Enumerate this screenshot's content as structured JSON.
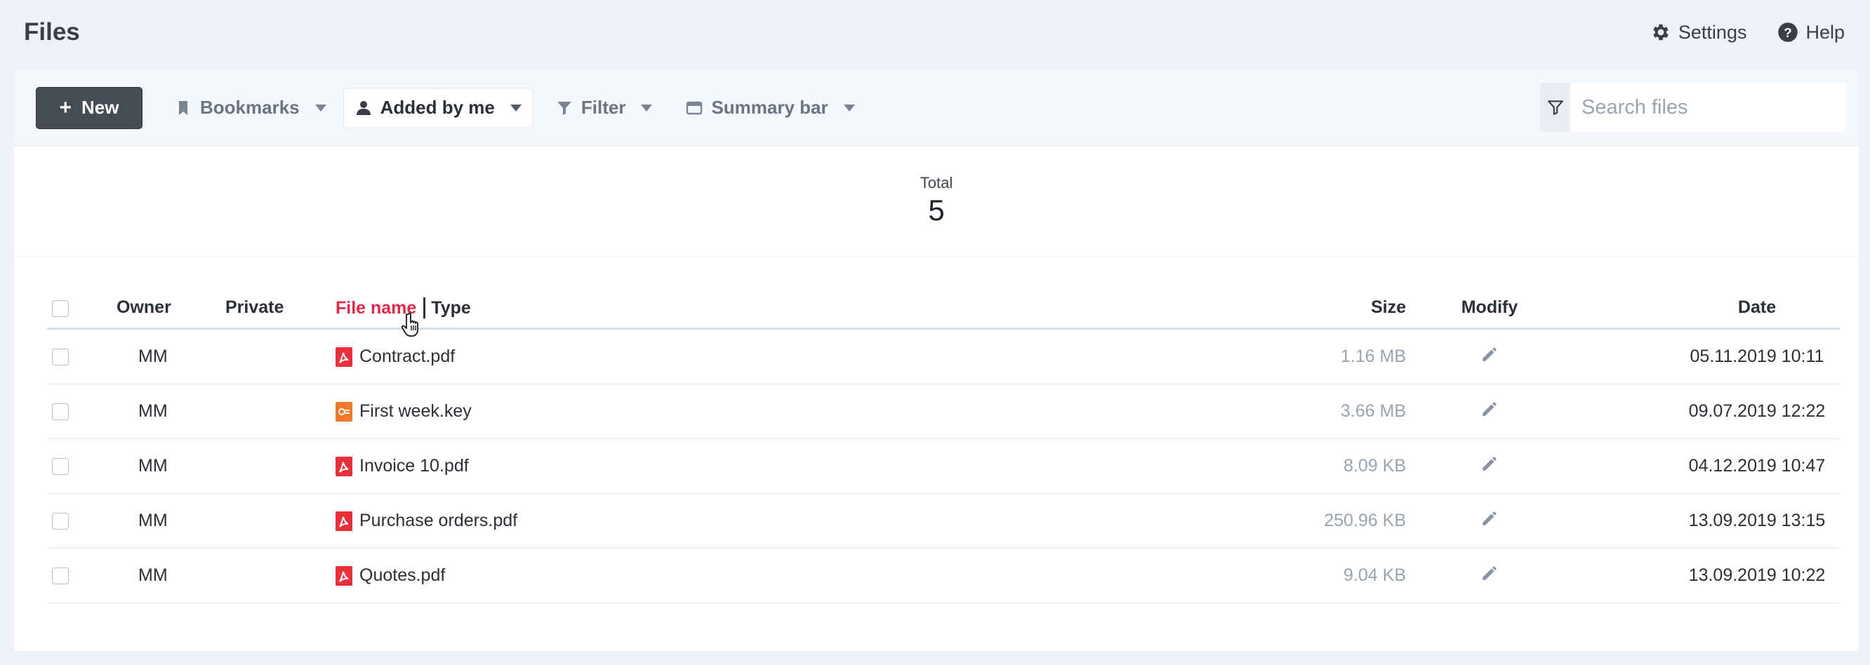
{
  "app": {
    "title": "Files"
  },
  "top_links": {
    "settings": "Settings",
    "help": "Help"
  },
  "toolbar": {
    "new_label": "New",
    "bookmarks": "Bookmarks",
    "added_by_me": "Added by me",
    "filter": "Filter",
    "summary_bar": "Summary bar",
    "search_placeholder": "Search files"
  },
  "summary": {
    "label": "Total",
    "value": "5"
  },
  "table": {
    "columns": {
      "owner": "Owner",
      "private": "Private",
      "file_name": "File name",
      "type": "Type",
      "size": "Size",
      "modify": "Modify",
      "date": "Date"
    },
    "rows": [
      {
        "owner": "MM",
        "name": "Contract.pdf",
        "icon": "pdf-file-icon",
        "size": "1.16 MB",
        "date": "05.11.2019 10:11"
      },
      {
        "owner": "MM",
        "name": "First week.key",
        "icon": "keynote-file-icon",
        "size": "3.66 MB",
        "date": "09.07.2019 12:22"
      },
      {
        "owner": "MM",
        "name": "Invoice 10.pdf",
        "icon": "pdf-file-icon",
        "size": "8.09 KB",
        "date": "04.12.2019 10:47"
      },
      {
        "owner": "MM",
        "name": "Purchase orders.pdf",
        "icon": "pdf-file-icon",
        "size": "250.96 KB",
        "date": "13.09.2019 13:15"
      },
      {
        "owner": "MM",
        "name": "Quotes.pdf",
        "icon": "pdf-file-icon",
        "size": "9.04 KB",
        "date": "13.09.2019 10:22"
      }
    ]
  },
  "colors": {
    "accent": "#e0284a",
    "pdf": "#e8303a",
    "keynote": "#f07a2c",
    "new_button": "#464c56"
  }
}
